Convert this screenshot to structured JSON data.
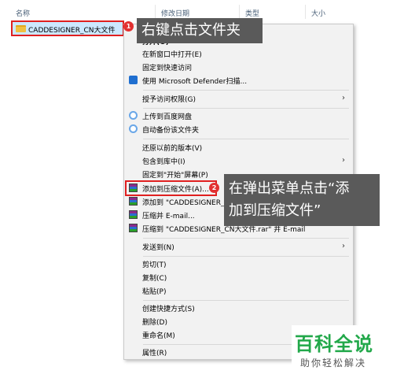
{
  "explorer": {
    "columns": {
      "name": "名称",
      "date": "修改日期",
      "type": "类型",
      "size": "大小"
    },
    "file_name": "CADDESIGNER_CN大文件"
  },
  "menu": {
    "items": [
      {
        "label": "打开(O)",
        "icon": ""
      },
      {
        "label": "在新窗口中打开(E)",
        "icon": ""
      },
      {
        "label": "固定到快速访问",
        "icon": ""
      },
      {
        "label": "使用 Microsoft Defender扫描...",
        "icon": "defender-shield-icon"
      },
      {
        "label": "授予访问权限(G)",
        "icon": "",
        "submenu": true
      },
      {
        "label": "上传到百度网盘",
        "icon": "baidu-cloud-icon"
      },
      {
        "label": "自动备份该文件夹",
        "icon": "baidu-cloud-icon"
      },
      {
        "label": "还原以前的版本(V)",
        "icon": ""
      },
      {
        "label": "包含到库中(I)",
        "icon": "",
        "submenu": true
      },
      {
        "label": "固定到\"开始\"屏幕(P)",
        "icon": ""
      },
      {
        "label": "添加到压缩文件(A)...",
        "icon": "winrar-icon"
      },
      {
        "label": "添加到 \"CADDESIGNER_CN大文件.rar\"(T)",
        "icon": "winrar-icon"
      },
      {
        "label": "压缩并 E-mail...",
        "icon": "winrar-icon"
      },
      {
        "label": "压缩到 \"CADDESIGNER_CN大文件.rar\" 并 E-mail",
        "icon": "winrar-icon"
      },
      {
        "label": "发送到(N)",
        "icon": "",
        "submenu": true
      },
      {
        "label": "剪切(T)",
        "icon": ""
      },
      {
        "label": "复制(C)",
        "icon": ""
      },
      {
        "label": "粘贴(P)",
        "icon": ""
      },
      {
        "label": "创建快捷方式(S)",
        "icon": ""
      },
      {
        "label": "删除(D)",
        "icon": ""
      },
      {
        "label": "重命名(M)",
        "icon": ""
      },
      {
        "label": "属性(R)",
        "icon": ""
      }
    ],
    "submenu_arrow": "›"
  },
  "annotations": {
    "badge1": "1",
    "badge2": "2",
    "callout1": "右键点击文件夹",
    "callout2_line1": "在弹出菜单点击“添",
    "callout2_line2": "加到压缩文件”"
  },
  "watermark": {
    "title": "百科全说",
    "subtitle": "助你轻松解决"
  },
  "colors": {
    "highlight_red": "#e02020",
    "callout_bg": "#5a5a5a",
    "watermark_green": "#22a84a",
    "selection_blue": "#cce8ff"
  }
}
